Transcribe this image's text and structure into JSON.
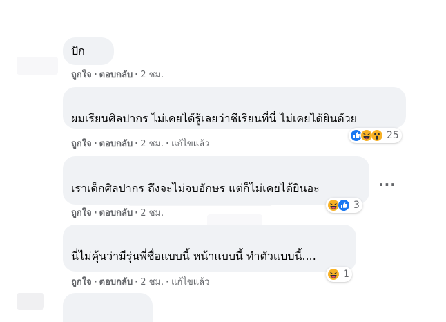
{
  "comments": [
    {
      "text": "ปัก",
      "like_label": "ถูกใจ",
      "reply_label": "ตอบกลับ",
      "time": "2 ชม.",
      "edited_label": "",
      "reactions": null
    },
    {
      "text": "ผมเรียนศิลปากร ไม่เคยได้รู้เลยว่าชีเรียนที่นี่ ไม่เคยได้ยินด้วย",
      "like_label": "ถูกใจ",
      "reply_label": "ตอบกลับ",
      "time": "2 ชม.",
      "edited_label": "แก้ไขแล้ว",
      "reactions": {
        "count": "25",
        "icons": [
          "like-icon",
          "haha-icon",
          "wow-icon"
        ]
      }
    },
    {
      "text": "เราเด็กศิลปากร ถึงจะไม่จบอักษร แต่ก็ไม่เคยได้ยินอะ",
      "like_label": "ถูกใจ",
      "reply_label": "ตอบกลับ",
      "time": "2 ชม.",
      "edited_label": "",
      "reactions": {
        "count": "3",
        "icons": [
          "haha-icon",
          "like-icon"
        ]
      }
    },
    {
      "text": "นี่ไม่คุ้นว่ามีรุ่นพี่ชื่อแบบนี้ หน้าแบบนี้ ทำตัวแบบนี้....",
      "like_label": "ถูกใจ",
      "reply_label": "ตอบกลับ",
      "time": "2 ชม.",
      "edited_label": "แก้ไขแล้ว",
      "reactions": {
        "count": "1",
        "icons": [
          "haha-icon"
        ]
      }
    }
  ],
  "more_options": "...",
  "colors": {
    "bubble": "#f0f2f5",
    "meta_text": "#65676b",
    "like_blue": "#1877f2",
    "haha_yellow": "#f7b125"
  }
}
